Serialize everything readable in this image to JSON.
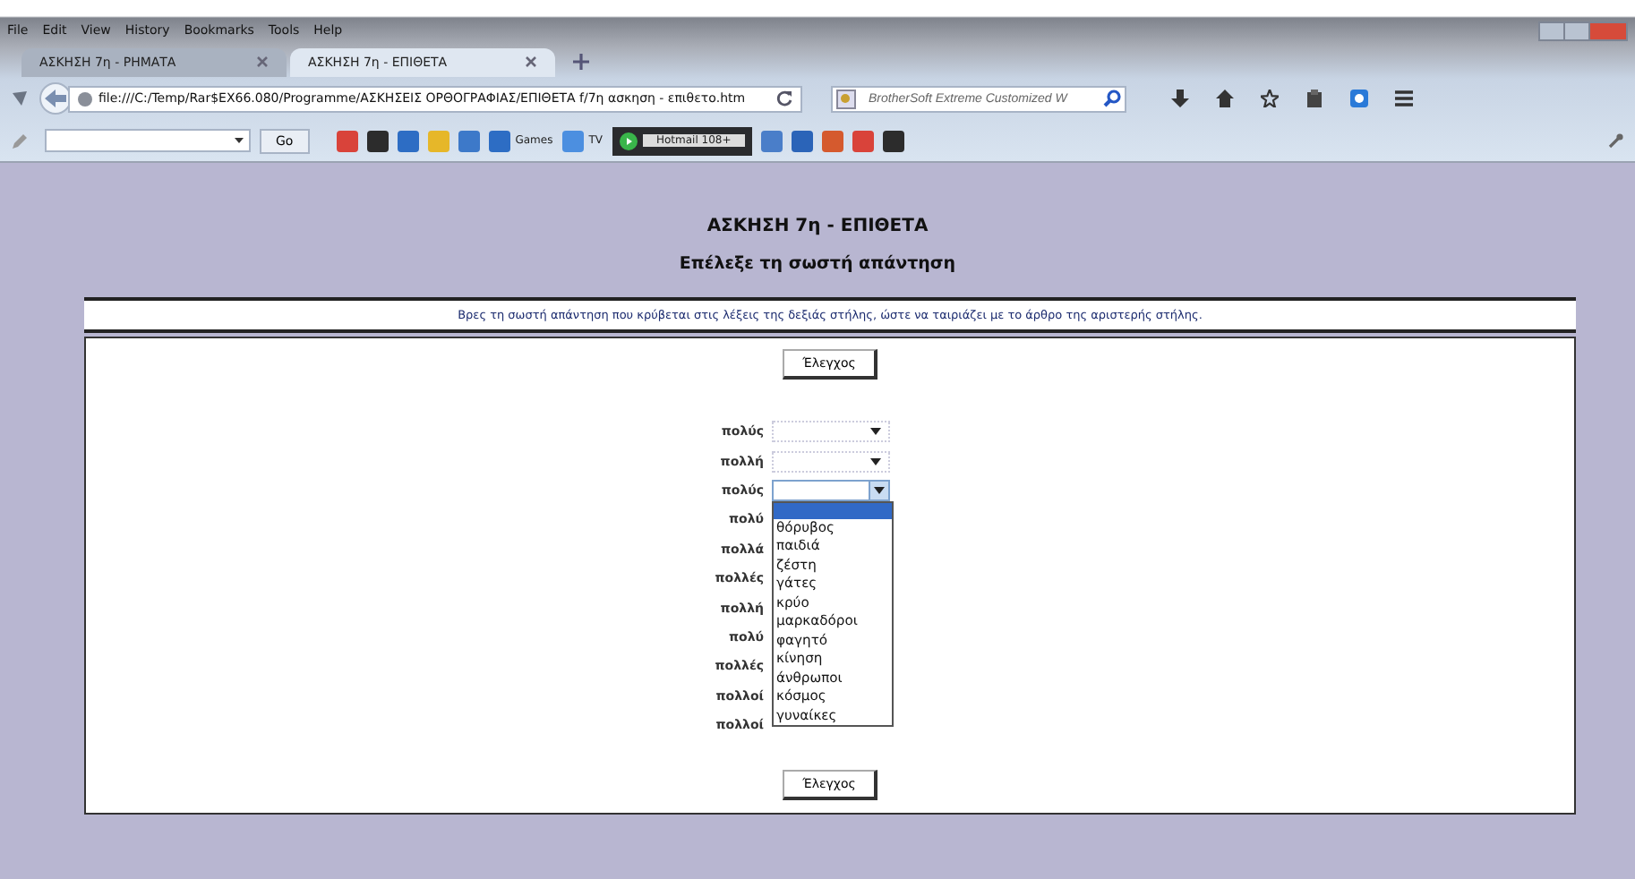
{
  "menu": [
    "File",
    "Edit",
    "View",
    "History",
    "Bookmarks",
    "Tools",
    "Help"
  ],
  "tabs": [
    {
      "label": "ΑΣΚΗΣΗ 7η - ΡΗΜΑΤΑ",
      "selected": false
    },
    {
      "label": "ΑΣΚΗΣΗ 7η - ΕΠΙΘΕΤΑ",
      "selected": true
    }
  ],
  "address": {
    "url": "file:///C:/Temp/Rar$EX66.080/Programme/ΑΣΚΗΣΕΙΣ ΟΡΘΟΓΡΑΦΙΑΣ/ΕΠΙΘΕΤΑ f/7η ασκηση - επιθετο.htm"
  },
  "search": {
    "placeholder": "BrotherSoft Extreme Customized W"
  },
  "toolbar": [
    {
      "kind": "go",
      "label": "Go"
    },
    {
      "kind": "icon"
    },
    {
      "kind": "icon"
    },
    {
      "kind": "icon"
    },
    {
      "kind": "icon"
    },
    {
      "kind": "icon"
    },
    {
      "kind": "labelled",
      "label": "Games"
    },
    {
      "kind": "labelled",
      "label": "TV"
    },
    {
      "kind": "player",
      "label": "Hotmail 108+"
    },
    {
      "kind": "icon"
    },
    {
      "kind": "icon"
    },
    {
      "kind": "icon"
    },
    {
      "kind": "icon"
    },
    {
      "kind": "icon"
    }
  ],
  "page": {
    "title": "ΑΣΚΗΣΗ 7η - ΕΠΙΘΕΤΑ",
    "subtitle": "Επέλεξε τη σωστή απάντηση",
    "instruction": "Βρες τη σωστή απάντηση που κρύβεται στις λέξεις της δεξιάς στήλης, ώστε να ταιριάζει με το άρθρο της αριστερής στήλης.",
    "check_buttons": [
      "Έλεγχος",
      "Έλεγχος"
    ],
    "rows": [
      {
        "label": "πολύς",
        "dropdown": {
          "open": false
        }
      },
      {
        "label": "πολλή",
        "dropdown": {
          "open": false
        }
      },
      {
        "label": "πολύς",
        "dropdown": {
          "open": true
        }
      },
      {
        "label": "πολύ"
      },
      {
        "label": "πολλά"
      },
      {
        "label": "πολλές"
      },
      {
        "label": "πολλή"
      },
      {
        "label": "πολύ"
      },
      {
        "label": "πολλές"
      },
      {
        "label": "πολλοί"
      },
      {
        "label": "πολλοί"
      }
    ],
    "dropdown_list": {
      "blank_highlighted": true,
      "options": [
        "θόρυβος",
        "παιδιά",
        "ζέστη",
        "γάτες",
        "κρύο",
        "μαρκαδόροι",
        "φαγητό",
        "κίνηση",
        "άνθρωποι",
        "κόσμος",
        "γυναίκες"
      ]
    }
  }
}
